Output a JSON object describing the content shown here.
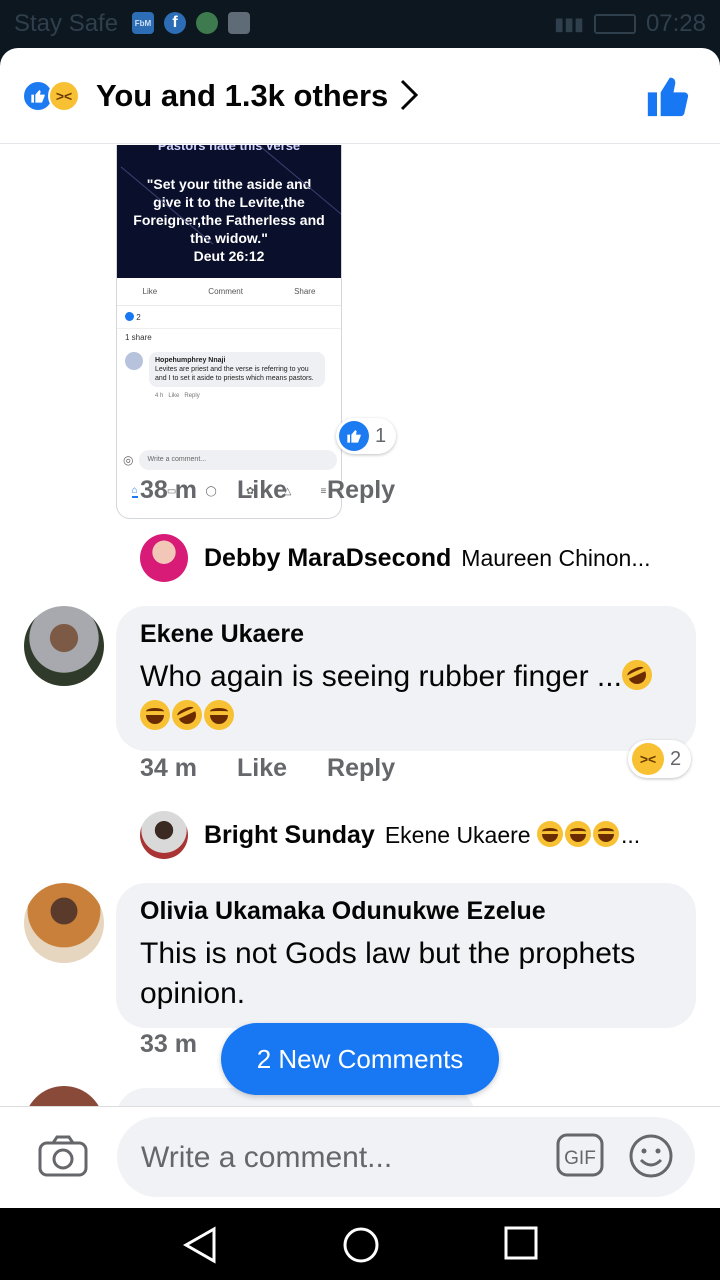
{
  "status_bar": {
    "carrier": "Stay Safe",
    "time": "07:28"
  },
  "reactions_header": {
    "title": "You and 1.3k others"
  },
  "shared_post": {
    "cut_text": "Pastors hate this verse",
    "quote": "\"Set your tithe aside and give it to the Levite,the Foreigner,the Fatherless and the widow.\"",
    "reference": "Deut 26:12",
    "actions": [
      "Like",
      "Comment",
      "Share"
    ],
    "reactions_count": "2",
    "shares": "1 share",
    "comment": {
      "author": "Hopehumphrey Nnaji",
      "text": "Levites are priest and the verse is referring to you and I to set it aside to priests which means pastors.",
      "time": "4 h",
      "like": "Like",
      "reply": "Reply"
    },
    "input_placeholder": "Write a comment..."
  },
  "post_comment": {
    "reaction_count": "1",
    "time": "38 m",
    "like": "Like",
    "reply": "Reply"
  },
  "reply_1": {
    "name": "Debby MaraDsecond",
    "text": "Maureen Chinon..."
  },
  "comment_2": {
    "name": "Ekene Ukaere",
    "text": "Who again is seeing rubber finger ...",
    "reaction_count": "2",
    "time": "34 m",
    "like": "Like",
    "reply": "Reply"
  },
  "reply_2": {
    "name": "Bright Sunday",
    "text": "Ekene Ukaere",
    "trail": "..."
  },
  "comment_3": {
    "name": "Olivia Ukamaka Odunukwe Ezelue",
    "text": "This is not Gods law but the prophets opinion.",
    "time": "33 m"
  },
  "new_comments": {
    "label": "2 New Comments"
  },
  "composer": {
    "placeholder": "Write a comment...",
    "gif": "GIF"
  },
  "colors": {
    "brand": "#1877f2",
    "bubble": "#f0f2f5",
    "meta": "#65676b"
  }
}
